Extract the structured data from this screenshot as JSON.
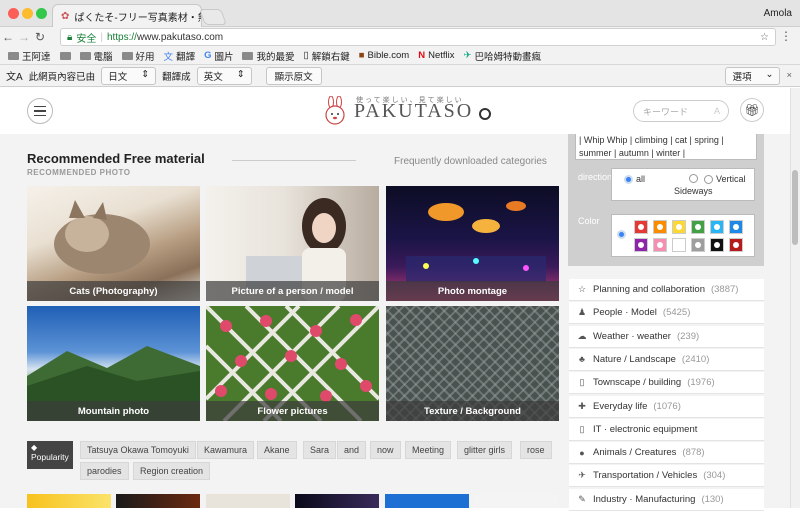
{
  "browser": {
    "tab_title": "ぱくたそ-フリー写真素材・無料",
    "profile": "Amola",
    "secure_label": "安全",
    "url_protocol": "https://",
    "url_host": "www.pakutaso.com",
    "bookmarks": [
      "王阿達",
      "電腦",
      "好用",
      "翻譯",
      "圖片",
      "我的最愛",
      "解鎖右鍵",
      "Bible.com",
      "Netflix",
      "巴哈姆特動畫瘋"
    ]
  },
  "translate_bar": {
    "prefix": "此網頁內容已由",
    "from_lang": "日文",
    "middle": "翻譯成",
    "to_lang": "英文",
    "show_original": "顯示原文",
    "options": "選項"
  },
  "site": {
    "logo": "PAKUTASO",
    "tagline": "使って楽しい、見て楽しい",
    "search_placeholder": "キーワード",
    "section_title": "Recommended Free material",
    "section_sub": "RECOMMENDED PHOTO",
    "freq_link": "Frequently downloaded categories",
    "tiles": [
      "Cats (Photography)",
      "Picture of a person / model",
      "Photo montage",
      "Mountain photo",
      "Flower pictures",
      "Texture / Background"
    ],
    "popularity_label": "Popularity",
    "tags": [
      "Tatsuya Okawa Tomoyuki",
      "Kawamura",
      "Akane",
      "Sara",
      "and",
      "now",
      "Meeting",
      "glitter girls",
      "rose",
      "parodies",
      "Region creation"
    ]
  },
  "sidebar": {
    "tag_text_line1": "| Whip Whip | climbing | cat | spring |",
    "tag_text_line2": "summer | autumn | winter |",
    "direction_label": "direction",
    "dir_all": "all",
    "dir_sideways": "Sideways",
    "dir_vertical": "Vertical",
    "color_label": "Color",
    "colors": [
      "#e53935",
      "#fb8c00",
      "#fdd835",
      "#43a047",
      "#29b6f6",
      "#1e88e5",
      "#8e24aa",
      "#f48fb1",
      "#ffffff",
      "#9e9e9e",
      "#111111",
      "#b71c1c"
    ],
    "categories": [
      {
        "icon": "☆",
        "label": "Planning and collaboration",
        "count": "(3887)"
      },
      {
        "icon": "♟",
        "label": "People · Model",
        "count": "(5425)"
      },
      {
        "icon": "☁",
        "label": "Weather · weather",
        "count": "(239)"
      },
      {
        "icon": "♣",
        "label": "Nature / Landscape",
        "count": "(2410)"
      },
      {
        "icon": "▯",
        "label": "Townscape / building",
        "count": "(1976)"
      },
      {
        "icon": "✚",
        "label": "Everyday life",
        "count": "(1076)"
      },
      {
        "icon": "▯",
        "label": "IT · electronic equipment",
        "count": ""
      },
      {
        "icon": "●",
        "label": "Animals / Creatures",
        "count": "(878)"
      },
      {
        "icon": "✈",
        "label": "Transportation / Vehicles",
        "count": "(304)"
      },
      {
        "icon": "✎",
        "label": "Industry · Manufacturing",
        "count": "(130)"
      }
    ]
  }
}
